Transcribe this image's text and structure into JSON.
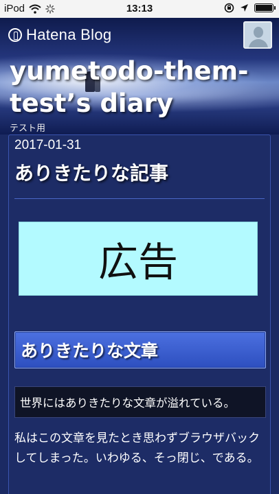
{
  "status_bar": {
    "carrier": "iPod",
    "time": "13:13",
    "battery_level": 0.92,
    "icons": [
      "wifi-icon",
      "loading-spinner-icon",
      "rotation-lock-icon",
      "location-arrow-icon",
      "battery-icon"
    ]
  },
  "header": {
    "brand": "Hatena Blog",
    "blog_title": "yumetodo-them-test’s diary",
    "blog_description": "テスト用",
    "avatar": "user-avatar"
  },
  "entry": {
    "date": "2017-01-31",
    "title": "ありきたりな記事",
    "ad_text": "広告",
    "heading": "ありきたりな文章",
    "quote": "世界にはありきたりな文章が溢れている。",
    "paragraph": "私はこの文章を見たとき思わずブラウザバックしてしまった。いわゆる、そっ閉じ、である。"
  },
  "colors": {
    "background": "#1b2a63",
    "accent": "#4c70e0",
    "ad_background": "#b3faff"
  }
}
